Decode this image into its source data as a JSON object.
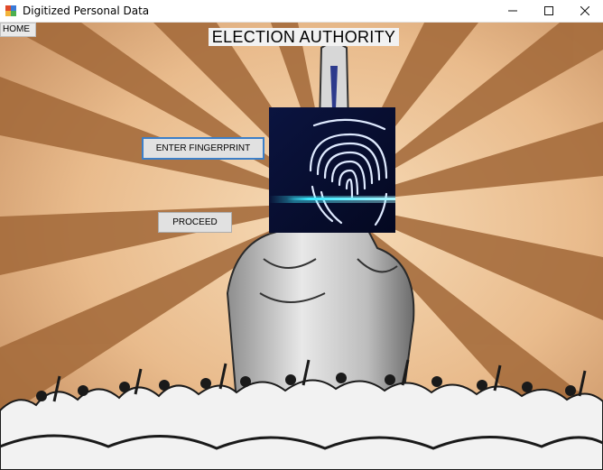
{
  "window": {
    "title": "Digitized Personal Data",
    "icons": [
      "app-icon",
      "minimize-icon",
      "maximize-icon",
      "close-icon"
    ]
  },
  "form": {
    "home_label": "HOME",
    "heading": "ELECTION AUTHORITY",
    "enter_fingerprint_label": "ENTER FINGERPRINT",
    "proceed_label": "PROCEED"
  },
  "images": {
    "background": "raised-finger-with-crowd-illustration",
    "scanner": "fingerprint-scan-image"
  },
  "colors": {
    "background_tan": "#e8b98a",
    "ray_dark": "#a26838",
    "scanner_bg": "#0a1236",
    "scanner_line": "#39e9ff",
    "focus_border": "#3c7fc8"
  }
}
